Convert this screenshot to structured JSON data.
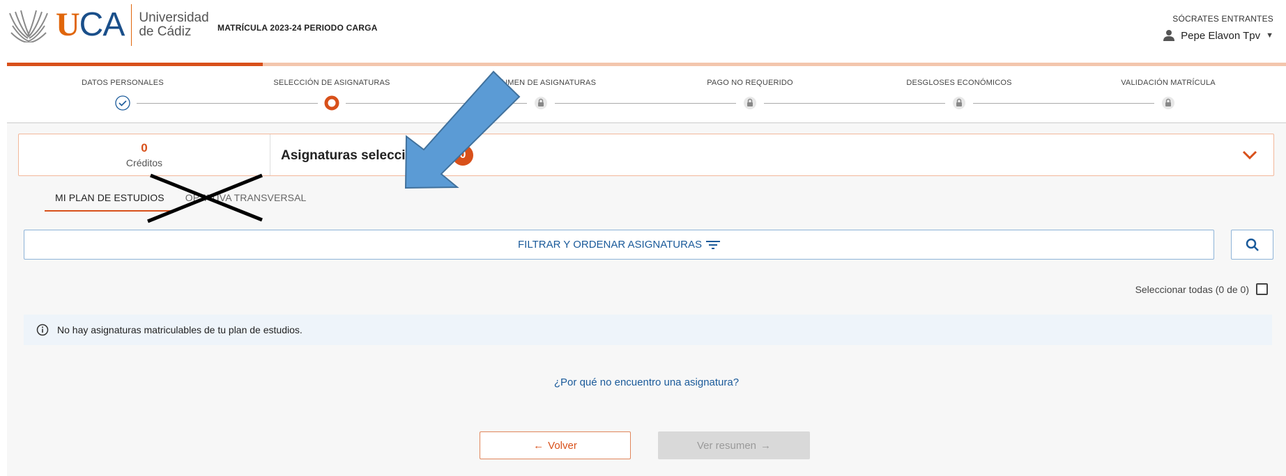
{
  "header": {
    "logo_uca_u": "U",
    "logo_uca_ca": "CA",
    "logo_line1": "Universidad",
    "logo_line2": "de Cádiz",
    "app_title": "MATRÍCULA 2023-24 PERIODO CARGA",
    "user_role": "SÓCRATES ENTRANTES",
    "user_name": "Pepe Elavon Tpv"
  },
  "progress": {
    "completed_fraction": 0.2
  },
  "stepper": {
    "steps": [
      {
        "label": "DATOS PERSONALES",
        "state": "done"
      },
      {
        "label": "SELECCIÓN DE ASIGNATURAS",
        "state": "current"
      },
      {
        "label": "RESUMEN DE ASIGNATURAS",
        "state": "locked"
      },
      {
        "label": "PAGO NO REQUERIDO",
        "state": "locked"
      },
      {
        "label": "DESGLOSES ECONÓMICOS",
        "state": "locked"
      },
      {
        "label": "VALIDACIÓN MATRÍCULA",
        "state": "locked"
      }
    ]
  },
  "credits": {
    "value": "0",
    "label": "Créditos",
    "selected_title": "Asignaturas seleccionadas",
    "selected_count": "0"
  },
  "tabs": [
    {
      "label": "MI PLAN DE ESTUDIOS",
      "active": true
    },
    {
      "label": "OPTATIVA TRANSVERSAL",
      "active": false
    }
  ],
  "filter": {
    "label": "FILTRAR Y ORDENAR ASIGNATURAS"
  },
  "select_all": {
    "label": "Seleccionar todas (0 de 0)"
  },
  "info": {
    "message": "No hay asignaturas matriculables de tu plan de estudios."
  },
  "help_link": "¿Por qué no encuentro una asignatura?",
  "buttons": {
    "back": "Volver",
    "next": "Ver resumen"
  },
  "colors": {
    "accent": "#d8501a",
    "brand_blue": "#1a4f8a",
    "link": "#1a5a9a",
    "annotation_arrow": "#5b9bd5"
  },
  "icons": {
    "user": "person-icon",
    "filter": "filter-icon",
    "search": "search-icon",
    "info": "info-icon",
    "lock": "lock-icon",
    "check": "check-circle-icon",
    "chevron": "chevron-down-icon"
  }
}
